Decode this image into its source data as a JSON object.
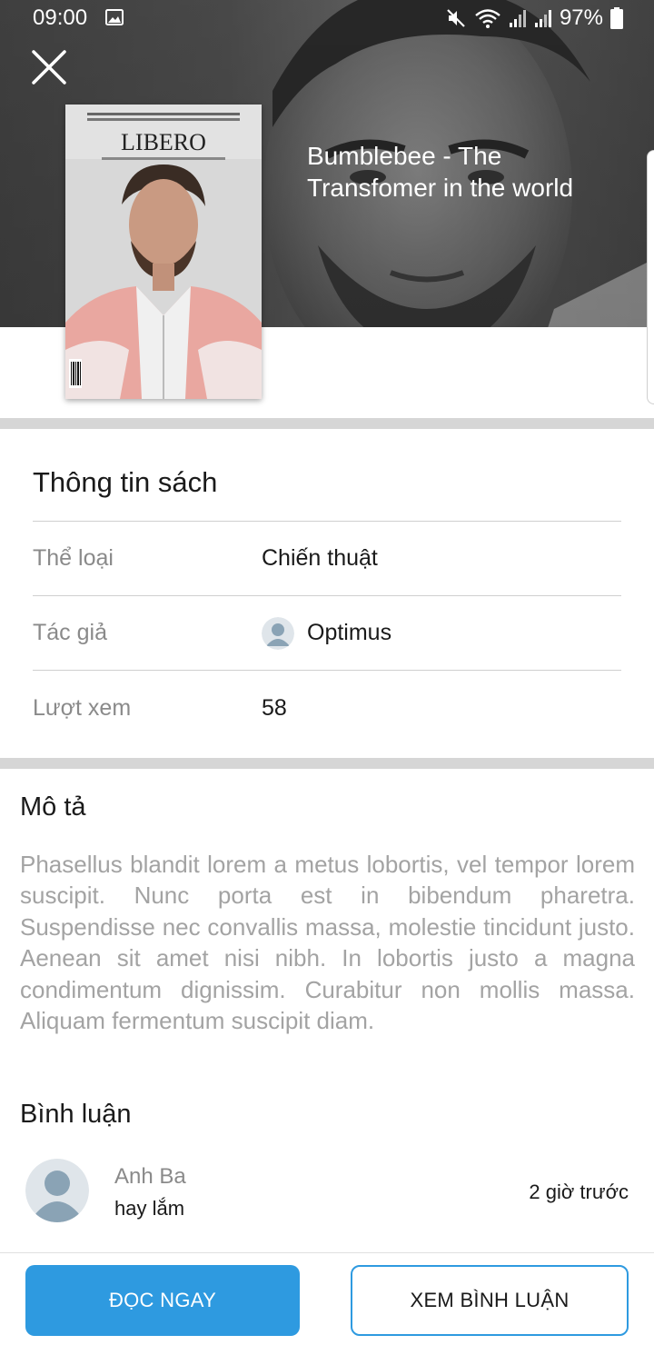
{
  "status_bar": {
    "time": "09:00",
    "battery": "97%",
    "icons": [
      "image-icon",
      "mute-icon",
      "wifi-icon",
      "signal-icon",
      "signal-icon",
      "battery-icon"
    ]
  },
  "header": {
    "close_icon": "close-icon",
    "title": "Bumblebee - The Transfomer in the world"
  },
  "cover": {
    "masthead": "LIBERO",
    "icon": "magazine-cover-image"
  },
  "book_info": {
    "heading": "Thông tin sách",
    "rows": [
      {
        "label": "Thể loại",
        "value": "Chiến thuật"
      },
      {
        "label": "Tác giả",
        "value": "Optimus",
        "icon": "user-avatar-icon"
      },
      {
        "label": "Lượt xem",
        "value": "58"
      }
    ]
  },
  "description": {
    "heading": "Mô tả",
    "body": "Phasellus blandit lorem a metus lobortis, vel tempor lorem suscipit. Nunc porta est in bibendum pharetra. Suspendisse nec convallis massa, molestie tincidunt justo. Aenean sit amet nisi nibh. In lobortis justo a magna condimentum dignissim. Curabitur non mollis massa. Aliquam fermentum suscipit diam."
  },
  "comments": {
    "heading": "Bình luận",
    "items": [
      {
        "name": "Anh Ba",
        "text": "hay lắm",
        "time": "2 giờ trước"
      }
    ]
  },
  "actions": {
    "read_now": "ĐỌC NGAY",
    "view_comments": "XEM BÌNH LUẬN"
  },
  "colors": {
    "accent": "#2e9ae0",
    "divider": "#d6d6d6",
    "muted_text": "#8a8a8a",
    "description_text": "#a3a3a3"
  }
}
